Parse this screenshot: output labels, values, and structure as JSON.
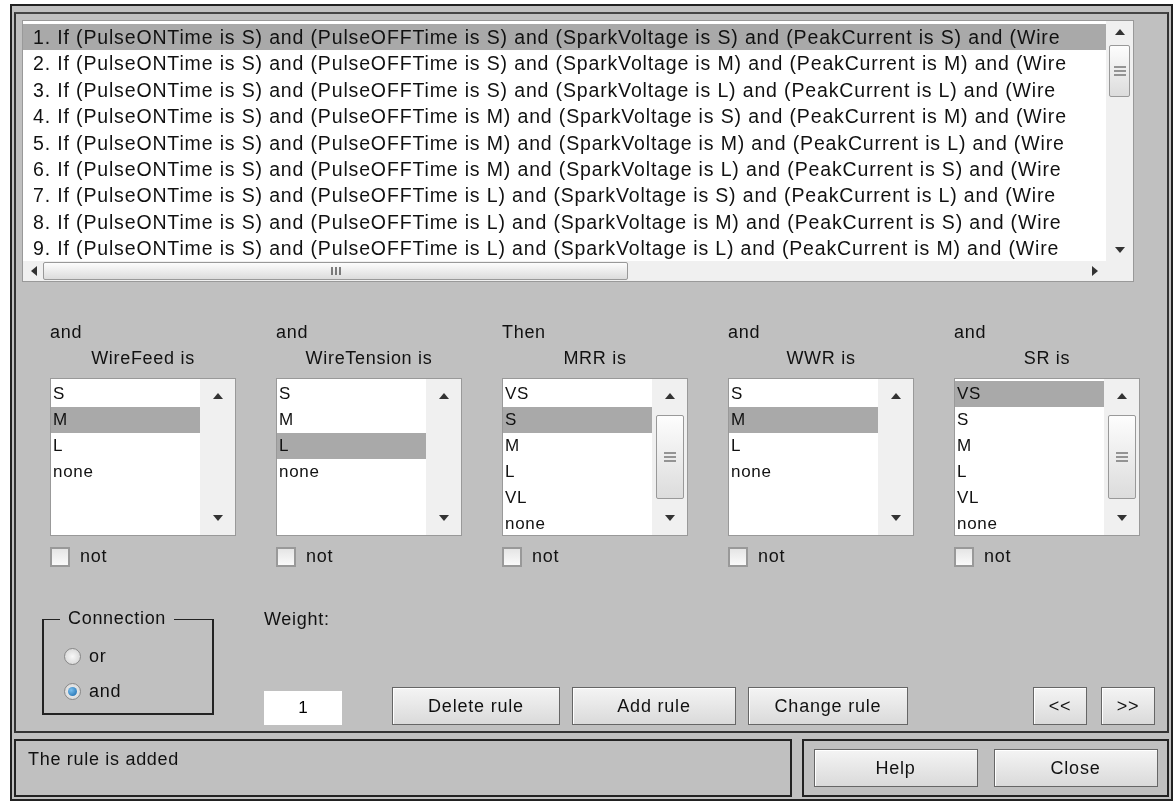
{
  "rules": [
    {
      "text": "1. If (PulseONTime is S) and (PulseOFFTime is S) and (SparkVoltage is S) and (PeakCurrent is S) and (Wire",
      "selected": true
    },
    {
      "text": "2. If (PulseONTime is S) and (PulseOFFTime is S) and (SparkVoltage is M) and (PeakCurrent is M) and (Wire",
      "selected": false
    },
    {
      "text": "3. If (PulseONTime is S) and (PulseOFFTime is S) and (SparkVoltage is L) and (PeakCurrent is L) and (Wire",
      "selected": false
    },
    {
      "text": "4. If (PulseONTime is S) and (PulseOFFTime is M) and (SparkVoltage is S) and (PeakCurrent is M) and (Wire",
      "selected": false
    },
    {
      "text": "5. If (PulseONTime is S) and (PulseOFFTime is M) and (SparkVoltage is M) and (PeakCurrent is L) and (Wire",
      "selected": false
    },
    {
      "text": "6. If (PulseONTime is S) and (PulseOFFTime is M) and (SparkVoltage is L) and (PeakCurrent is S) and (Wire",
      "selected": false
    },
    {
      "text": "7. If (PulseONTime is S) and (PulseOFFTime is L) and (SparkVoltage is S) and (PeakCurrent is L) and (Wire",
      "selected": false
    },
    {
      "text": "8. If (PulseONTime is S) and (PulseOFFTime is L) and (SparkVoltage is M) and (PeakCurrent is S) and (Wire",
      "selected": false
    },
    {
      "text": "9. If (PulseONTime is S) and (PulseOFFTime is L) and (SparkVoltage is L) and (PeakCurrent is M) and (Wire",
      "selected": false
    }
  ],
  "variables": [
    {
      "connector": "and",
      "label": "WireFeed is",
      "not_checked": false,
      "options": [
        {
          "label": "S",
          "selected": false
        },
        {
          "label": "M",
          "selected": true
        },
        {
          "label": "L",
          "selected": false
        },
        {
          "label": "none",
          "selected": false
        }
      ],
      "not_label": "not"
    },
    {
      "connector": "and",
      "label": "WireTension is",
      "not_checked": false,
      "options": [
        {
          "label": "S",
          "selected": false
        },
        {
          "label": "M",
          "selected": false
        },
        {
          "label": "L",
          "selected": true
        },
        {
          "label": "none",
          "selected": false
        }
      ],
      "not_label": "not"
    },
    {
      "connector": "Then",
      "label": "MRR is",
      "not_checked": false,
      "options": [
        {
          "label": "VS",
          "selected": false
        },
        {
          "label": "S",
          "selected": true
        },
        {
          "label": "M",
          "selected": false
        },
        {
          "label": "L",
          "selected": false
        },
        {
          "label": "VL",
          "selected": false
        },
        {
          "label": "none",
          "selected": false
        }
      ],
      "not_label": "not"
    },
    {
      "connector": "and",
      "label": "WWR is",
      "not_checked": false,
      "options": [
        {
          "label": "S",
          "selected": false
        },
        {
          "label": "M",
          "selected": true
        },
        {
          "label": "L",
          "selected": false
        },
        {
          "label": "none",
          "selected": false
        }
      ],
      "not_label": "not"
    },
    {
      "connector": "and",
      "label": "SR is",
      "not_checked": false,
      "options": [
        {
          "label": "VS",
          "selected": true
        },
        {
          "label": "S",
          "selected": false
        },
        {
          "label": "M",
          "selected": false
        },
        {
          "label": "L",
          "selected": false
        },
        {
          "label": "VL",
          "selected": false
        },
        {
          "label": "none",
          "selected": false
        }
      ],
      "not_label": "not"
    }
  ],
  "connection": {
    "title": "Connection",
    "options": [
      {
        "label": "or",
        "selected": false
      },
      {
        "label": "and",
        "selected": true
      }
    ]
  },
  "weight": {
    "label": "Weight:",
    "value": "1"
  },
  "actions": [
    "Delete rule",
    "Add rule",
    "Change rule"
  ],
  "navigation": [
    "<<",
    ">>"
  ],
  "status": "The rule is added",
  "footer_buttons": [
    "Help",
    "Close"
  ]
}
